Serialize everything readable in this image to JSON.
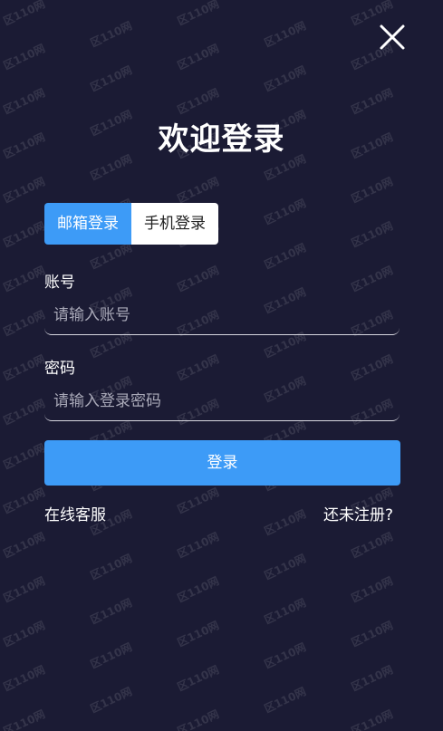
{
  "page": {
    "title": "欢迎登录"
  },
  "tabs": [
    {
      "label": "邮箱登录",
      "active": true
    },
    {
      "label": "手机登录",
      "active": false
    }
  ],
  "account": {
    "label": "账号",
    "placeholder": "请输入账号",
    "value": ""
  },
  "password": {
    "label": "密码",
    "placeholder": "请输入登录密码",
    "value": ""
  },
  "actions": {
    "login_label": "登录",
    "online_service": "在线客服",
    "register_link": "还未注册?"
  },
  "watermark": {
    "text": "区110网"
  },
  "colors": {
    "background": "#1b1b34",
    "accent": "#3d9bf7",
    "text": "#ffffff"
  },
  "icons": {
    "close": "close-icon"
  }
}
